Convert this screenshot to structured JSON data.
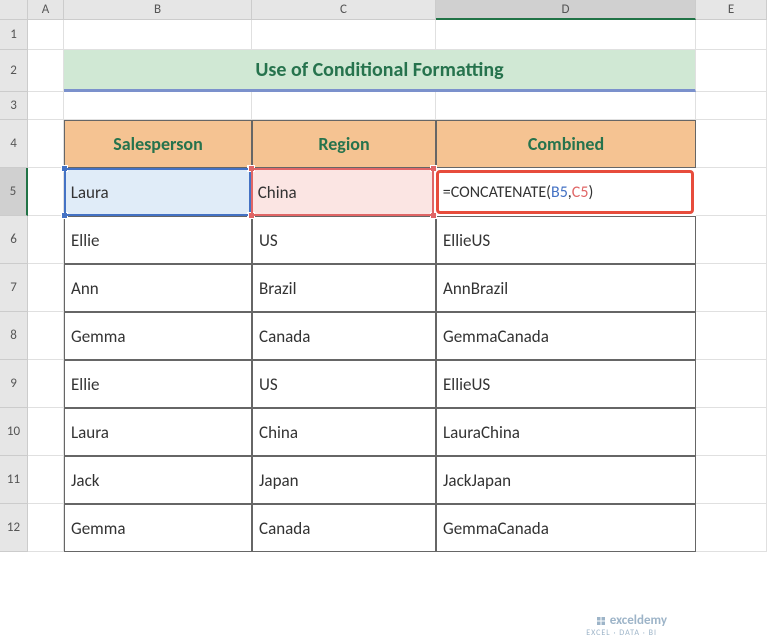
{
  "columns": [
    "A",
    "B",
    "C",
    "D",
    "E"
  ],
  "title": "Use of Conditional Formatting",
  "headers": {
    "b": "Salesperson",
    "c": "Region",
    "d": "Combined"
  },
  "rows": [
    {
      "b": "Laura",
      "c": "China",
      "d_formula": {
        "func": "=CONCATENATE(",
        "refb": "B5",
        "comma": ",",
        "refc": "C5",
        "close": ")"
      }
    },
    {
      "b": "Ellie",
      "c": "US",
      "d": "EllieUS"
    },
    {
      "b": "Ann",
      "c": "Brazil",
      "d": "AnnBrazil"
    },
    {
      "b": "Gemma",
      "c": "Canada",
      "d": "GemmaCanada"
    },
    {
      "b": "Ellie",
      "c": "US",
      "d": "EllieUS"
    },
    {
      "b": "Laura",
      "c": "China",
      "d": "LauraChina"
    },
    {
      "b": "Jack",
      "c": "Japan",
      "d": "JackJapan"
    },
    {
      "b": "Gemma",
      "c": "Canada",
      "d": "GemmaCanada"
    }
  ],
  "row_numbers": [
    "1",
    "2",
    "3",
    "4",
    "5",
    "6",
    "7",
    "8",
    "9",
    "10",
    "11",
    "12"
  ],
  "watermark": {
    "brand": "exceldemy",
    "tagline": "EXCEL · DATA · BI"
  },
  "chart_data": {
    "type": "table",
    "title": "Use of Conditional Formatting",
    "columns": [
      "Salesperson",
      "Region",
      "Combined"
    ],
    "rows": [
      [
        "Laura",
        "China",
        "=CONCATENATE(B5,C5)"
      ],
      [
        "Ellie",
        "US",
        "EllieUS"
      ],
      [
        "Ann",
        "Brazil",
        "AnnBrazil"
      ],
      [
        "Gemma",
        "Canada",
        "GemmaCanada"
      ],
      [
        "Ellie",
        "US",
        "EllieUS"
      ],
      [
        "Laura",
        "China",
        "LauraChina"
      ],
      [
        "Jack",
        "Japan",
        "JackJapan"
      ],
      [
        "Gemma",
        "Canada",
        "GemmaCanada"
      ]
    ]
  }
}
